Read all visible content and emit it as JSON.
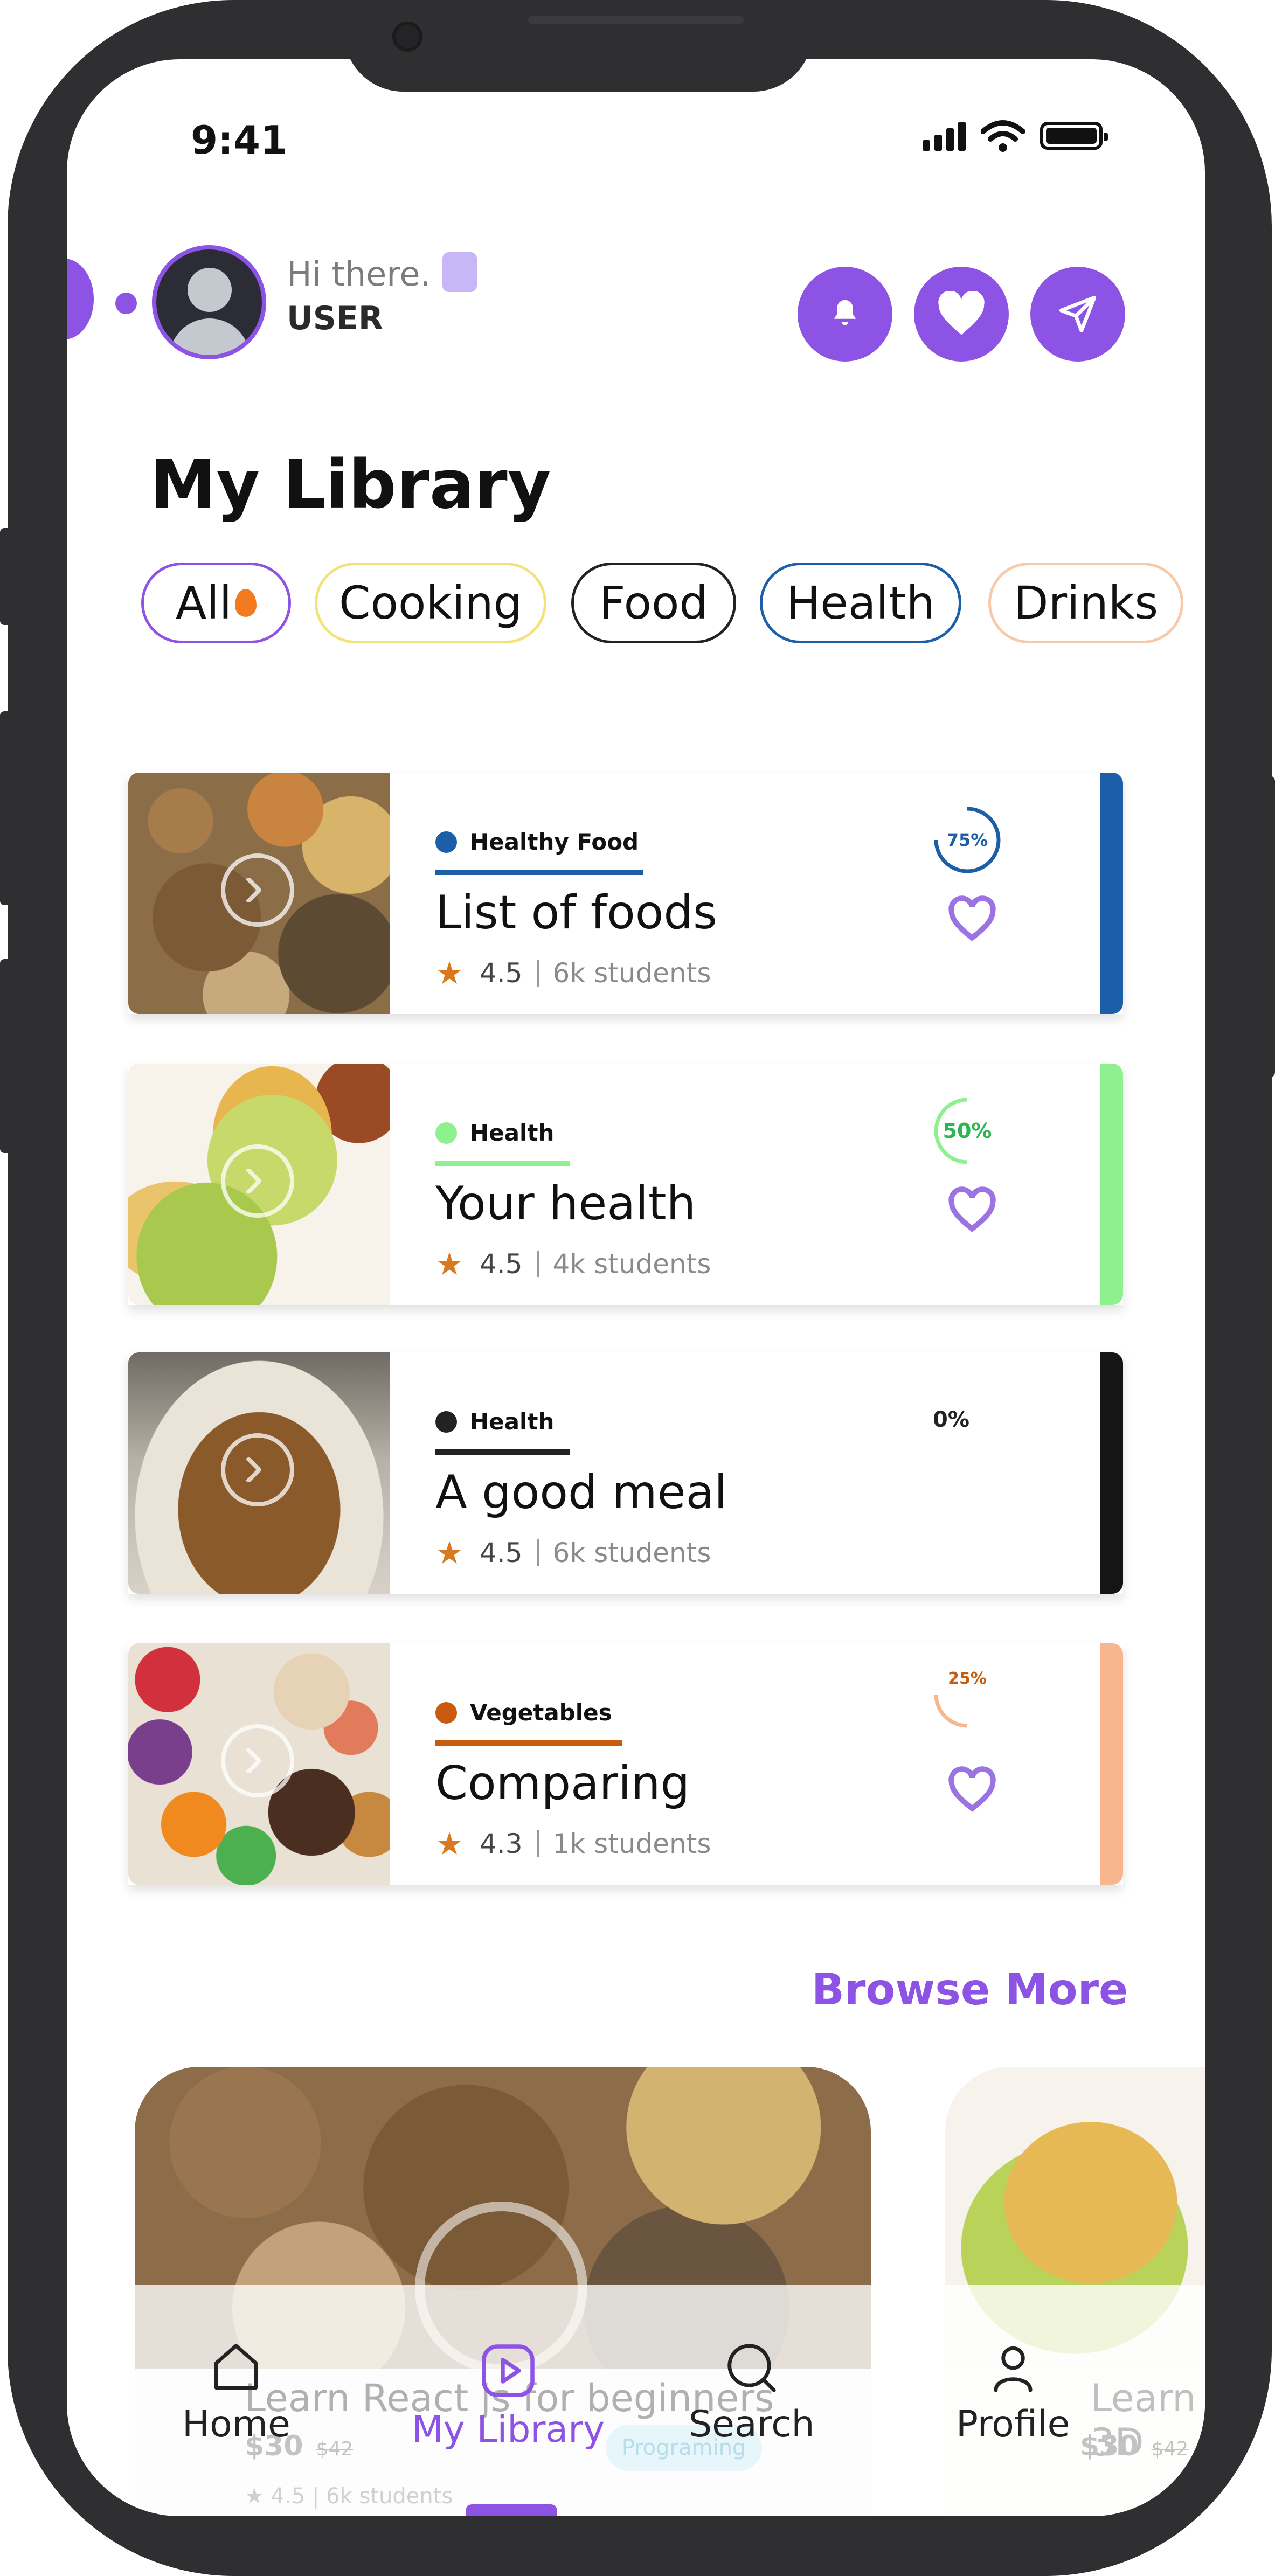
{
  "status_bar": {
    "time": "9:41"
  },
  "header": {
    "greeting": "Hi there.",
    "username": "USER",
    "actions": [
      {
        "icon": "bell-icon"
      },
      {
        "icon": "heart-icon"
      },
      {
        "icon": "send-icon"
      }
    ]
  },
  "library": {
    "title": "My Library",
    "filters": [
      "All",
      "Cooking",
      "Food",
      "Health",
      "Drinks"
    ],
    "courses": [
      {
        "category": "Healthy Food",
        "title": "List of foods",
        "rating": "4.5",
        "students": "6k students",
        "progress": "75%",
        "progress_value": 75,
        "accent": "#1c5ea7"
      },
      {
        "category": "Health",
        "title": "Your health",
        "rating": "4.5",
        "students": "4k students",
        "progress": "50%",
        "progress_value": 50,
        "accent": "#8ff08f"
      },
      {
        "category": "Health",
        "title": "A good meal",
        "rating": "4.5",
        "students": "6k students",
        "progress": "0%",
        "progress_value": 0,
        "accent": "#151515"
      },
      {
        "category": "Vegetables",
        "title": "Comparing",
        "rating": "4.3",
        "students": "1k students",
        "progress": "25%",
        "progress_value": 25,
        "accent": "#c85b10"
      }
    ],
    "browse_more": "Browse More"
  },
  "featured": [
    {
      "title": "Learn React js for beginners",
      "price": "$30",
      "old_price": "$42",
      "tag": "Programing",
      "rating": "4.5",
      "students": "6k students"
    },
    {
      "title": "Learn 3D",
      "price": "$30",
      "old_price": "$42"
    }
  ],
  "tabbar": {
    "items": [
      "Home",
      "My Library",
      "Search",
      "Profile"
    ],
    "active": "My Library"
  },
  "colors": {
    "brand": "#8d53e4"
  }
}
